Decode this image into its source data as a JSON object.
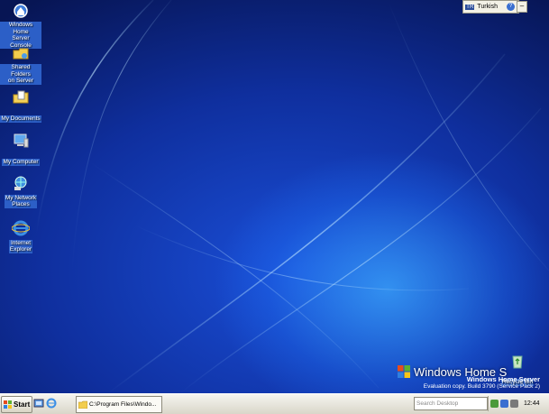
{
  "desktop_icons": [
    {
      "name": "Windows Home Server Console",
      "line1": "Windows Home",
      "line2": "Server Console",
      "icon": "home-server-icon"
    },
    {
      "name": "Shared Folders on Server",
      "line1": "Shared Folders",
      "line2": "on Server",
      "icon": "shared-folder-icon"
    },
    {
      "name": "My Documents",
      "line1": "My Documents",
      "line2": "",
      "icon": "documents-folder-icon"
    },
    {
      "name": "My Computer",
      "line1": "My Computer",
      "line2": "",
      "icon": "computer-icon"
    },
    {
      "name": "My Network Places",
      "line1": "My Network",
      "line2": "Places",
      "icon": "network-icon"
    },
    {
      "name": "Internet Explorer",
      "line1": "Internet",
      "line2": "Explorer",
      "icon": "ie-icon"
    }
  ],
  "recycle_bin": {
    "label": "Recycle Bin",
    "icon": "recycle-bin-icon"
  },
  "language_bar": {
    "code": "TR",
    "language": "Turkish",
    "help": "?"
  },
  "branding": {
    "logo_text": "Windows Home S",
    "product": "Windows Home Server",
    "edition": "Evaluation copy. Build 3790 (Service Pack 2)"
  },
  "taskbar": {
    "start_label": "Start",
    "task_button": "C:\\Program Files\\Windo...",
    "search_placeholder": "Search Desktop",
    "clock": "12:44"
  },
  "colors": {
    "desktop_blue": "#0f2f9e",
    "taskbar": "#ece9d8",
    "start_green": "#3c8a2e"
  }
}
